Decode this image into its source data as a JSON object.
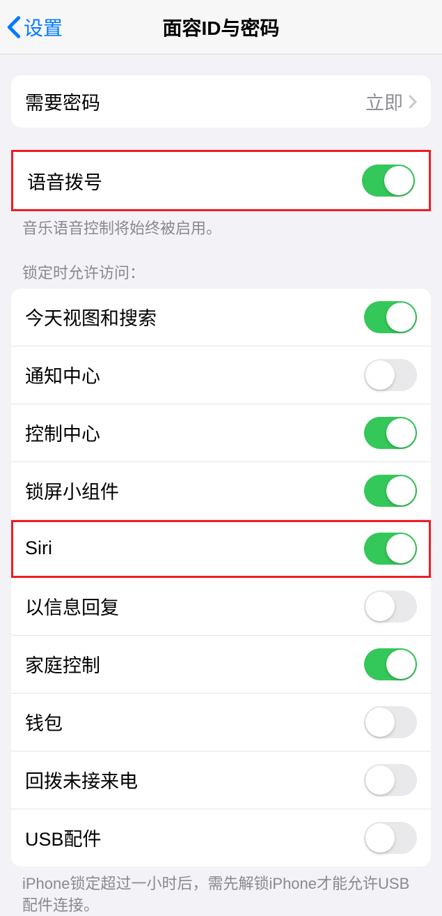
{
  "nav": {
    "back_label": "设置",
    "title": "面容ID与密码"
  },
  "require_passcode": {
    "label": "需要密码",
    "value": "立即"
  },
  "voice_dial": {
    "label": "语音拨号",
    "enabled": true,
    "footer": "音乐语音控制将始终被启用。"
  },
  "lock_screen_access": {
    "header": "锁定时允许访问：",
    "items": [
      {
        "label": "今天视图和搜索",
        "enabled": true
      },
      {
        "label": "通知中心",
        "enabled": false
      },
      {
        "label": "控制中心",
        "enabled": true
      },
      {
        "label": "锁屏小组件",
        "enabled": true
      },
      {
        "label": "Siri",
        "enabled": true
      },
      {
        "label": "以信息回复",
        "enabled": false
      },
      {
        "label": "家庭控制",
        "enabled": true
      },
      {
        "label": "钱包",
        "enabled": false
      },
      {
        "label": "回拨未接来电",
        "enabled": false
      },
      {
        "label": "USB配件",
        "enabled": false
      }
    ],
    "footer": "iPhone锁定超过一小时后，需先解锁iPhone才能允许USB配件连接。"
  }
}
